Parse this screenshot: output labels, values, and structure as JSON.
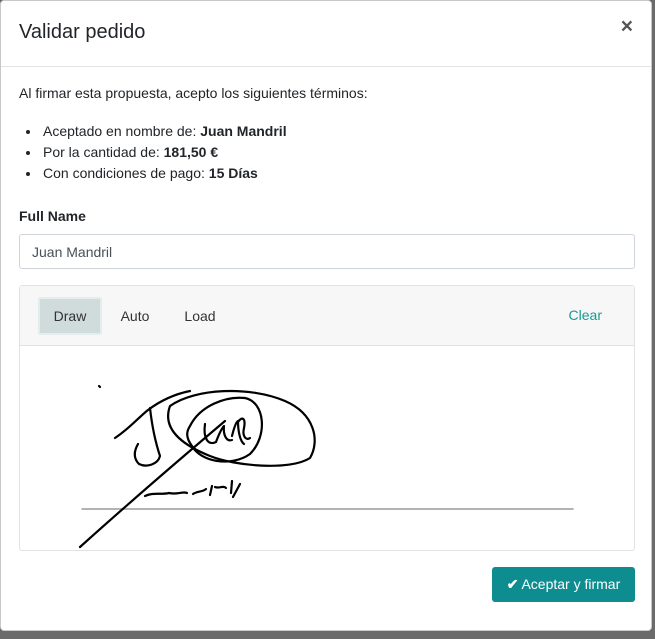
{
  "modal": {
    "title": "Validar pedido",
    "close_label": "×"
  },
  "intro": "Al firmar esta propuesta, acepto los siguientes términos:",
  "terms": [
    {
      "label": "Aceptado en nombre de: ",
      "value": "Juan Mandril"
    },
    {
      "label": "Por la cantidad de: ",
      "value": "181,50 €"
    },
    {
      "label": "Con condiciones de pago: ",
      "value": "15 Días"
    }
  ],
  "full_name": {
    "label": "Full Name",
    "value": "Juan Mandril"
  },
  "signature": {
    "tabs": [
      "Draw",
      "Auto",
      "Load"
    ],
    "active_tab": "Draw",
    "clear_label": "Clear"
  },
  "actions": {
    "accept_label": "Aceptar y firmar",
    "accept_icon": "check-icon"
  },
  "colors": {
    "accent": "#0e8d90",
    "link": "#1a9a94",
    "active_tab_bg": "#cfdcdb"
  }
}
